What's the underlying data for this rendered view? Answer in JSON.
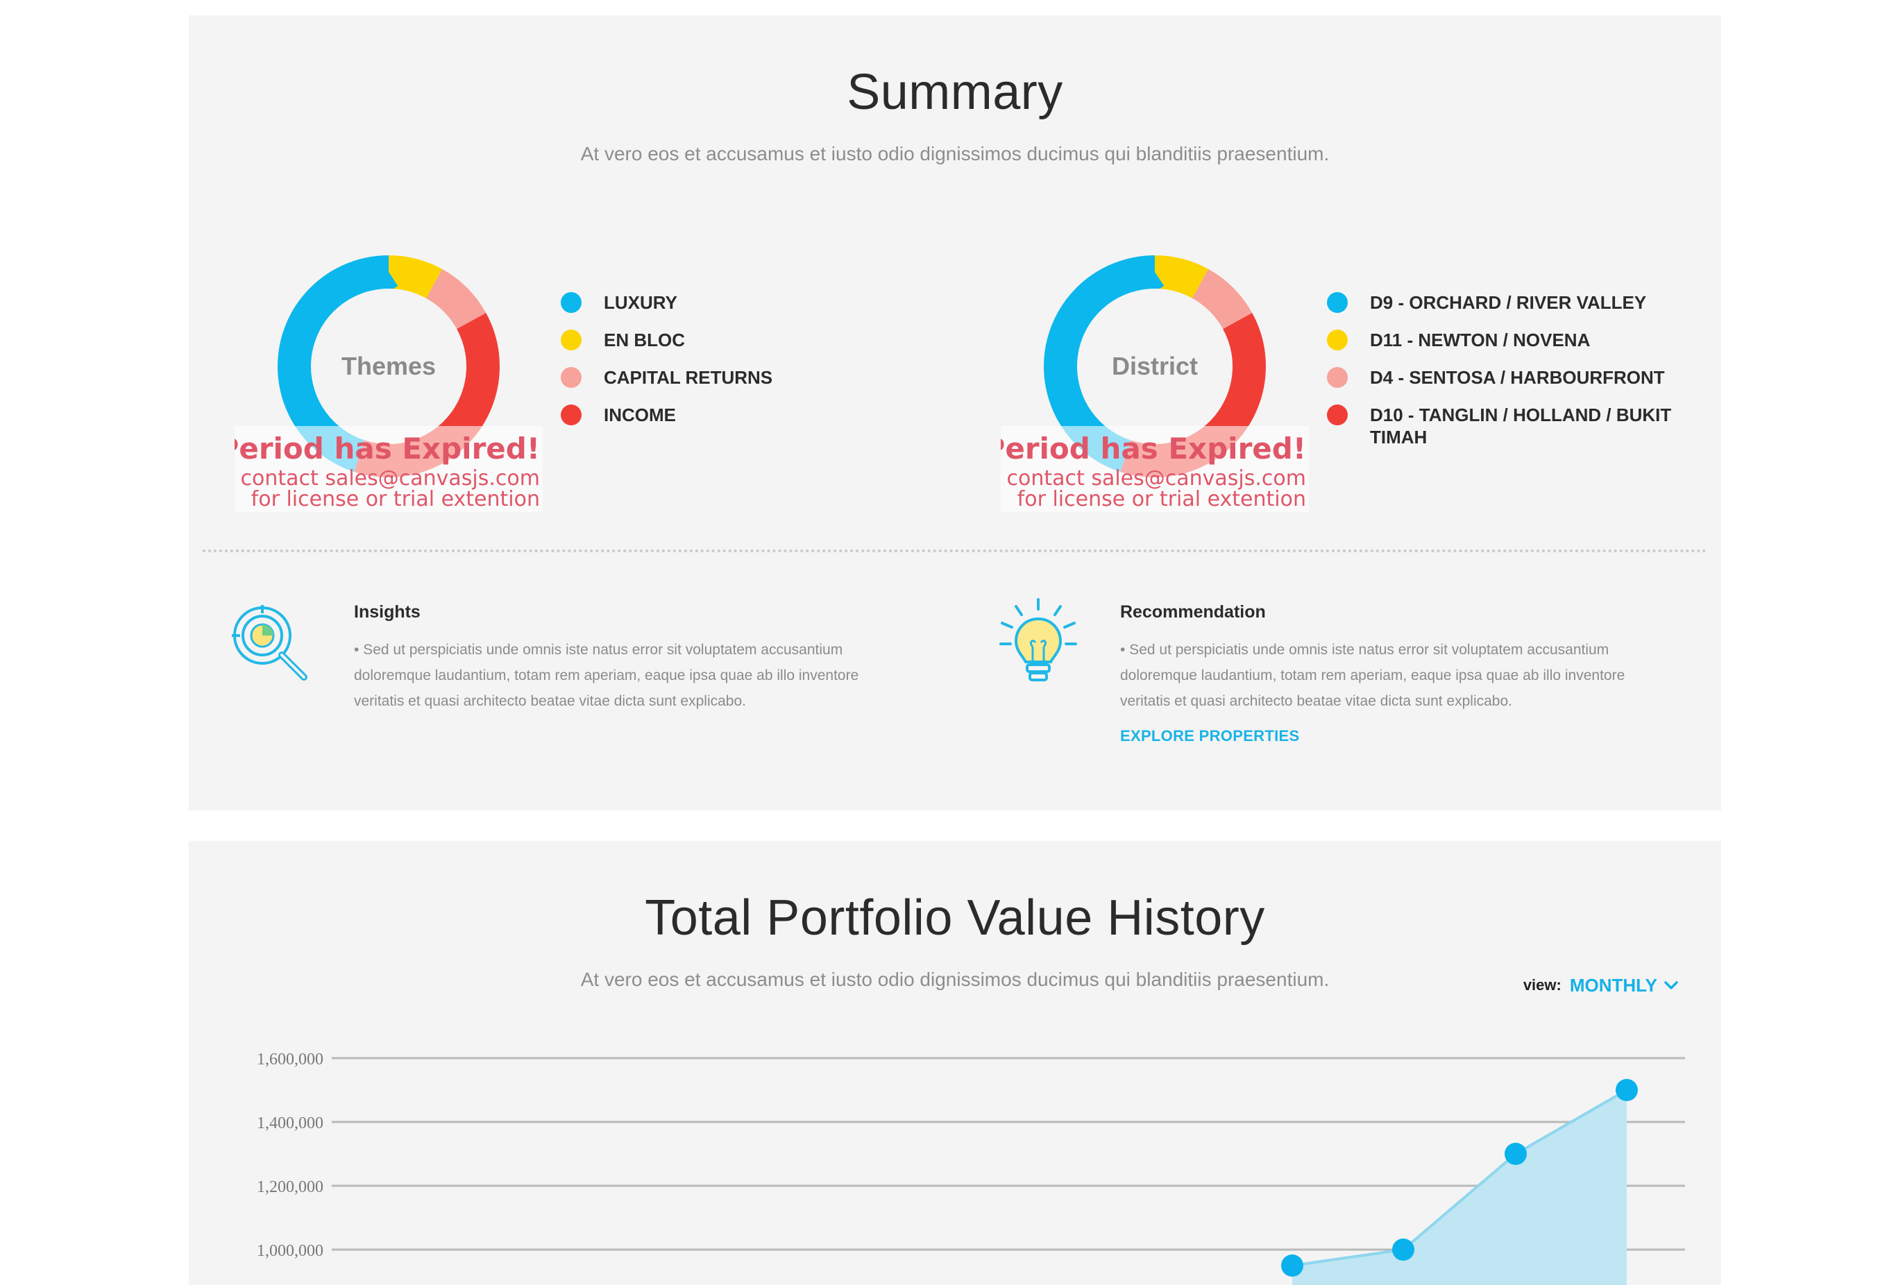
{
  "summary": {
    "title": "Summary",
    "subtitle": "At vero eos et accusamus et iusto odio dignissimos ducimus qui blanditiis praesentium.",
    "themes": {
      "center_label": "Themes",
      "legend": [
        {
          "label": "LUXURY",
          "color": "#0bb7ed"
        },
        {
          "label": "EN BLOC",
          "color": "#fcd500"
        },
        {
          "label": "CAPITAL RETURNS",
          "color": "#f7a29a"
        },
        {
          "label": "INCOME",
          "color": "#f03e36"
        }
      ]
    },
    "district": {
      "center_label": "District",
      "legend": [
        {
          "label": "D9 - ORCHARD / RIVER VALLEY",
          "color": "#0bb7ed"
        },
        {
          "label": "D11 - NEWTON / NOVENA",
          "color": "#fcd500"
        },
        {
          "label": "D4 - SENTOSA / HARBOURFRONT",
          "color": "#f7a29a"
        },
        {
          "label": "D10 - TANGLIN / HOLLAND / BUKIT TIMAH",
          "color": "#f03e36"
        }
      ]
    },
    "watermark": {
      "title": "Period has Expired!",
      "line1": "Please contact sales@canvasjs.com",
      "line2": "for license or trial extention"
    },
    "insights": {
      "title": "Insights",
      "text": "• Sed ut perspiciatis unde omnis iste natus error sit voluptatem accusantium doloremque laudantium, totam rem aperiam, eaque ipsa quae ab illo inventore veritatis et quasi architecto beatae vitae dicta sunt explicabo."
    },
    "recommendation": {
      "title": "Recommendation",
      "text": "• Sed ut perspiciatis unde omnis iste natus error sit voluptatem accusantium doloremque laudantium, totam rem aperiam, eaque ipsa quae ab illo inventore veritatis et quasi architecto beatae vitae dicta sunt explicabo.",
      "link": "EXPLORE PROPERTIES"
    }
  },
  "history": {
    "title": "Total Portfolio Value History",
    "subtitle": "At vero eos et accusamus et iusto odio dignissimos ducimus qui blanditiis praesentium.",
    "view_label": "view:",
    "view_value": "MONTHLY"
  },
  "colors": {
    "accent": "#15b0e8",
    "panel": "#f4f4f4",
    "area_fill": "#bfe6f2",
    "area_line": "#8fd6ee",
    "point": "#0bb1ec"
  },
  "chart_data": [
    {
      "type": "pie",
      "center_label": "Themes",
      "categories": [
        "LUXURY",
        "EN BLOC",
        "CAPITAL RETURNS",
        "INCOME"
      ],
      "values": [
        45,
        8,
        9,
        38
      ],
      "colors": [
        "#0bb7ed",
        "#fcd500",
        "#f7a29a",
        "#f03e36"
      ]
    },
    {
      "type": "pie",
      "center_label": "District",
      "categories": [
        "D9 - ORCHARD / RIVER VALLEY",
        "D11 - NEWTON / NOVENA",
        "D4 - SENTOSA / HARBOURFRONT",
        "D10 - TANGLIN / HOLLAND / BUKIT TIMAH"
      ],
      "values": [
        45,
        8,
        9,
        38
      ],
      "colors": [
        "#0bb7ed",
        "#fcd500",
        "#f7a29a",
        "#f03e36"
      ]
    },
    {
      "type": "area",
      "title": "Total Portfolio Value History",
      "ylim": [
        800000,
        1600000
      ],
      "yticks": [
        1000000,
        1200000,
        1400000,
        1600000
      ],
      "ytick_labels": [
        "1,000,000",
        "1,200,000",
        "1,400,000",
        "1,600,000"
      ],
      "series": [
        {
          "values": [
            950000,
            1000000,
            1300000,
            1500000
          ]
        }
      ]
    }
  ]
}
